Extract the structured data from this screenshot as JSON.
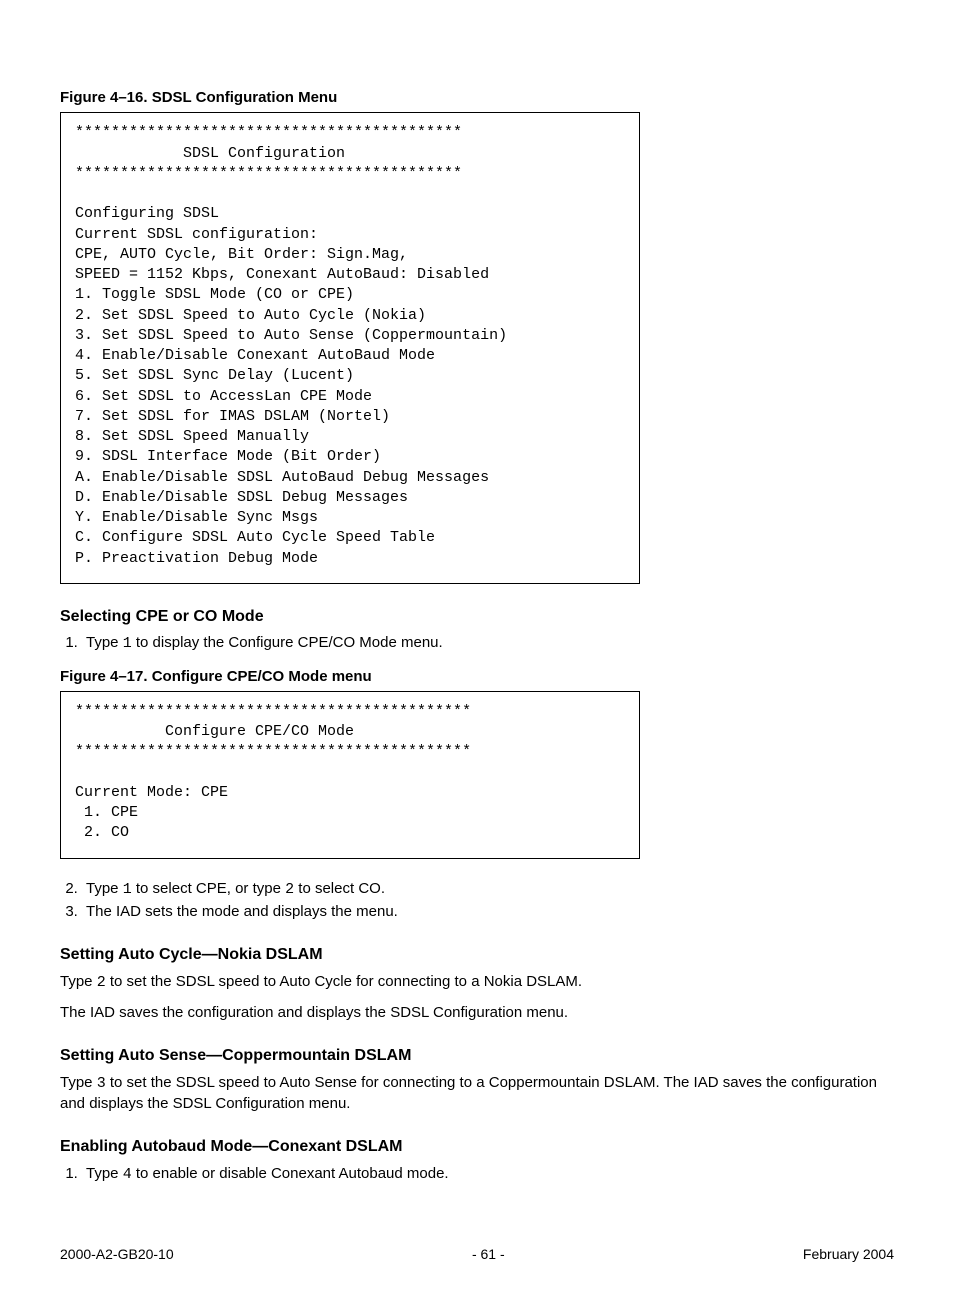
{
  "figure1": {
    "caption": "Figure 4–16.  SDSL Configuration Menu",
    "lines": [
      "*******************************************",
      "            SDSL Configuration",
      "*******************************************",
      "",
      "Configuring SDSL",
      "Current SDSL configuration:",
      "CPE, AUTO Cycle, Bit Order: Sign.Mag,",
      "SPEED = 1152 Kbps, Conexant AutoBaud: Disabled",
      "1. Toggle SDSL Mode (CO or CPE)",
      "2. Set SDSL Speed to Auto Cycle (Nokia)",
      "3. Set SDSL Speed to Auto Sense (Coppermountain)",
      "4. Enable/Disable Conexant AutoBaud Mode",
      "5. Set SDSL Sync Delay (Lucent)",
      "6. Set SDSL to AccessLan CPE Mode",
      "7. Set SDSL for IMAS DSLAM (Nortel)",
      "8. Set SDSL Speed Manually",
      "9. SDSL Interface Mode (Bit Order)",
      "A. Enable/Disable SDSL AutoBaud Debug Messages",
      "D. Enable/Disable SDSL Debug Messages",
      "Y. Enable/Disable Sync Msgs",
      "C. Configure SDSL Auto Cycle Speed Table",
      "P. Preactivation Debug Mode"
    ]
  },
  "section1": {
    "heading": "Selecting CPE or CO Mode",
    "step1_pre": "Type ",
    "step1_code": "1",
    "step1_post": " to display the Configure CPE/CO Mode menu."
  },
  "figure2": {
    "caption": "Figure 4–17.  Configure CPE/CO Mode menu",
    "lines": [
      "********************************************",
      "          Configure CPE/CO Mode",
      "********************************************",
      "",
      "Current Mode: CPE",
      " 1. CPE",
      " 2. CO"
    ]
  },
  "section1b": {
    "step2_a": "Type ",
    "step2_code1": "1",
    "step2_b": " to select CPE, or type ",
    "step2_code2": "2",
    "step2_c": " to select CO.",
    "step3": "The IAD sets the mode and displays the menu."
  },
  "section2": {
    "heading": "Setting Auto Cycle—Nokia DSLAM",
    "p1_a": "Type ",
    "p1_code": "2",
    "p1_b": " to set the SDSL speed to Auto Cycle for connecting to a Nokia DSLAM.",
    "p2": "The IAD saves the configuration and displays the SDSL Configuration menu."
  },
  "section3": {
    "heading": "Setting Auto Sense—Coppermountain DSLAM",
    "p1_a": "Type ",
    "p1_code": "3",
    "p1_b": " to set the SDSL speed to Auto Sense for connecting to a Coppermountain DSLAM. The IAD saves the configuration and displays the SDSL Configuration menu."
  },
  "section4": {
    "heading": "Enabling Autobaud Mode—Conexant DSLAM",
    "step1_a": "Type ",
    "step1_code": "4",
    "step1_b": " to enable or disable Conexant Autobaud mode."
  },
  "footer": {
    "left": "2000-A2-GB20-10",
    "center": "- 61 -",
    "right": "February 2004"
  }
}
